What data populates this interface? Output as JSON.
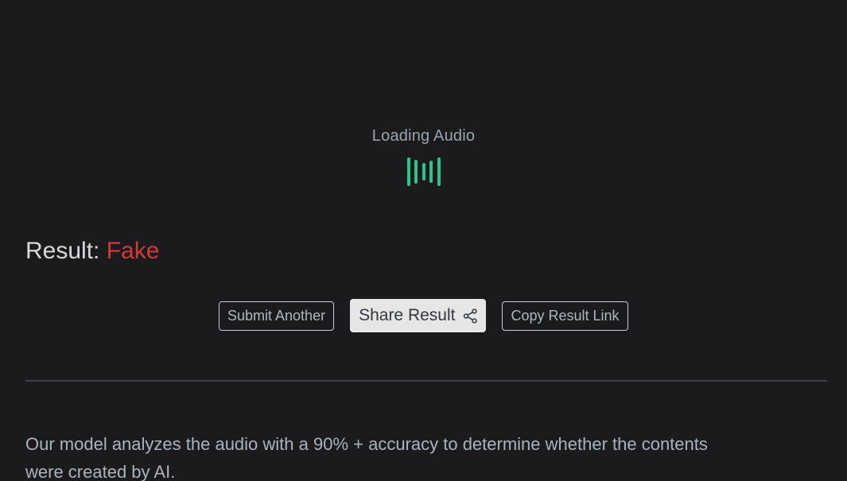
{
  "loading": {
    "label": "Loading Audio",
    "indicator_icon": "audio-wave-icon",
    "accent_color": "#2bc48a"
  },
  "result": {
    "prefix": "Result:",
    "verdict": "Fake",
    "verdict_color": "#d13a34"
  },
  "actions": {
    "submit_another": "Submit Another",
    "share_result": "Share Result",
    "share_icon": "share-icon",
    "copy_link": "Copy Result Link"
  },
  "description": "Our model analyzes the audio with a 90% + accuracy to determine whether the contents were created by AI."
}
